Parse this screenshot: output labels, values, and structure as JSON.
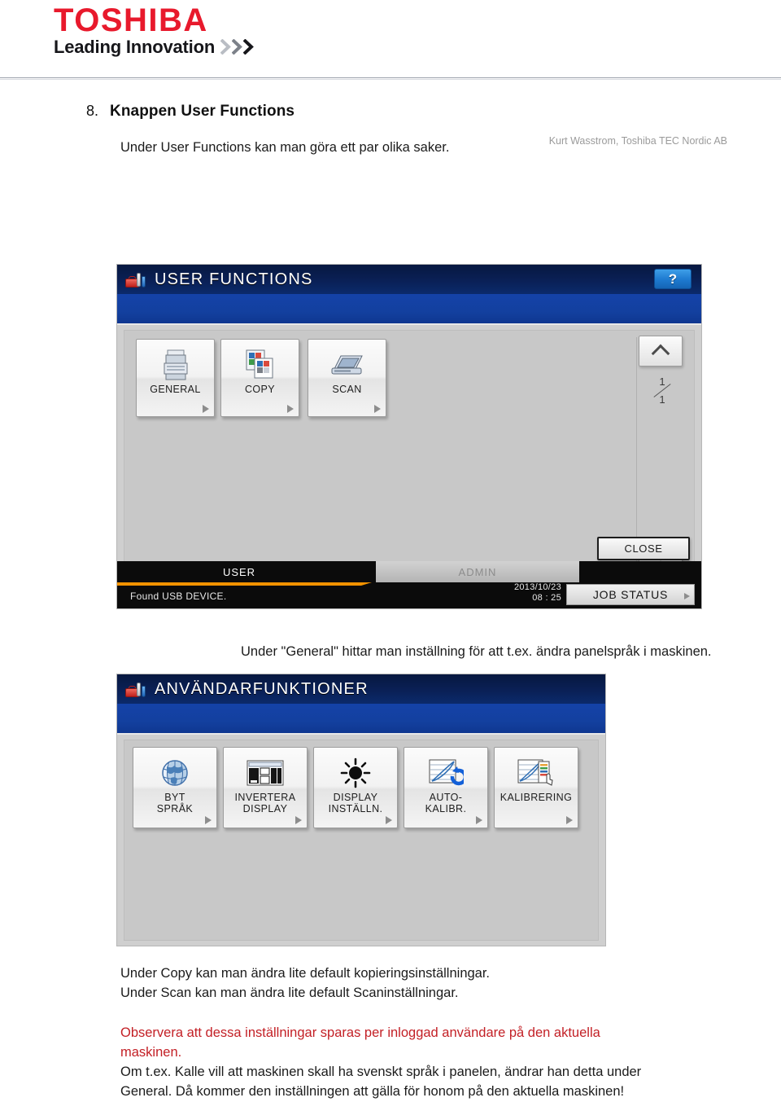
{
  "brand": {
    "name": "TOSHIBA",
    "tagline": "Leading Innovation",
    "chevron_icon": "triple-chevron-right-icon",
    "red": "#e8192c"
  },
  "section": {
    "number": "8.",
    "title": "Knappen User Functions",
    "intro": "Under User Functions kan man göra ett par olika saker."
  },
  "panel1": {
    "toolbox_icon": "toolbox-icon",
    "title": "USER FUNCTIONS",
    "help_label": "?",
    "help_icon": "help-question-icon",
    "tiles": [
      {
        "label": "GENERAL",
        "icon": "printer-icon",
        "arrow_icon": "triangle-right-icon"
      },
      {
        "label": "COPY",
        "icon": "copy-pages-icon",
        "arrow_icon": "triangle-right-icon"
      },
      {
        "label": "SCAN",
        "icon": "scanner-icon",
        "arrow_icon": "triangle-right-icon"
      }
    ],
    "scroll": {
      "up_icon": "chevron-up-icon",
      "down_icon": "chevron-down-icon",
      "page_current": "1",
      "page_total": "1"
    },
    "close_label": "CLOSE",
    "status": {
      "tab_user": "USER",
      "tab_admin": "ADMIN",
      "message": "Found USB DEVICE.",
      "date": "2013/10/23",
      "time": "08 : 25",
      "job_status_label": "JOB STATUS",
      "job_status_arrow_icon": "triangle-right-icon",
      "accent": "#f29200"
    }
  },
  "between_text": "Under \"General\" hittar man inställning för att t.ex. ändra panelspråk i maskinen.",
  "panel2": {
    "toolbox_icon": "toolbox-icon",
    "title": "ANVÄNDARFUNKTIONER",
    "tiles": [
      {
        "label_line1": "BYT",
        "label_line2": "SPRÅK",
        "icon": "globe-icon",
        "arrow_icon": "triangle-right-icon"
      },
      {
        "label_line1": "INVERTERA",
        "label_line2": "DISPLAY",
        "icon": "invert-display-icon",
        "arrow_icon": "triangle-right-icon"
      },
      {
        "label_line1": "DISPLAY",
        "label_line2": "INSTÄLLN.",
        "icon": "brightness-sun-icon",
        "arrow_icon": "triangle-right-icon"
      },
      {
        "label_line1": "AUTO-",
        "label_line2": "KALIBR.",
        "icon": "auto-calibration-icon",
        "arrow_icon": "triangle-right-icon"
      },
      {
        "label_line1": "KALIBRERING",
        "label_line2": "",
        "icon": "calibration-hand-icon",
        "arrow_icon": "triangle-right-icon"
      }
    ]
  },
  "body_text": {
    "line1": "Under Copy kan man ändra lite default kopieringsinställningar.",
    "line2": "Under Scan kan man ändra lite default Scaninställningar.",
    "note_line1": "Observera att dessa inställningar sparas per inloggad användare på den aktuella",
    "note_line2": "maskinen.",
    "note_color": "#c32026",
    "line3": "Om t.ex. Kalle vill att maskinen skall ha svenskt språk i panelen, ändrar han detta under",
    "line4": "General. Då kommer den inställningen att gälla för honom på den aktuella maskinen!"
  },
  "footer": "Kurt Wasstrom, Toshiba TEC Nordic AB"
}
